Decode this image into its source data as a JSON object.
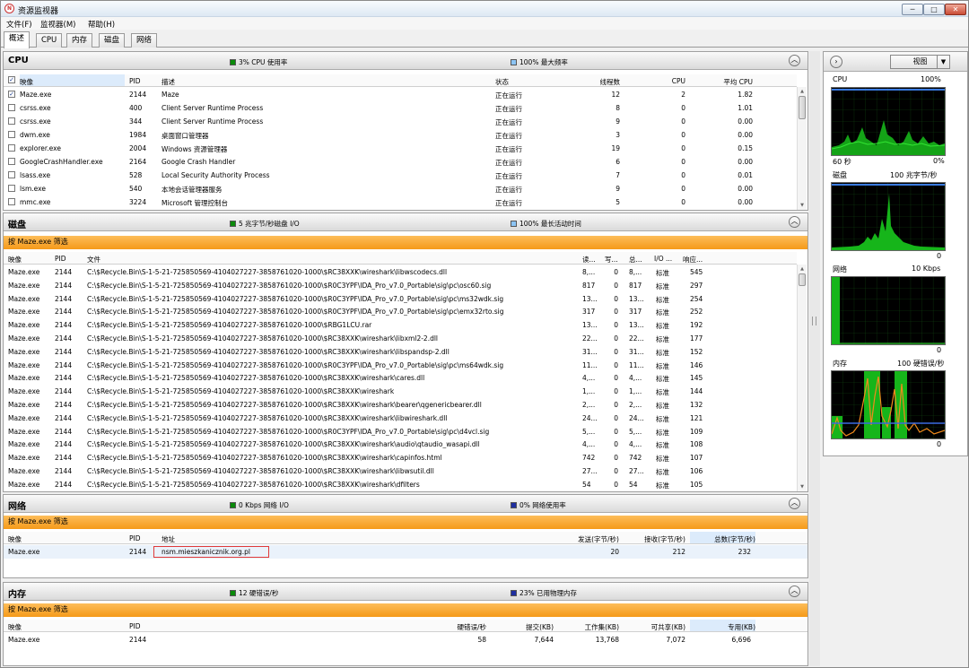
{
  "window": {
    "title": "资源监视器",
    "icon": "resource-monitor-icon",
    "min_label": "─",
    "max_label": "□",
    "close_label": "✕"
  },
  "menu": [
    "文件(F)",
    "监视器(M)",
    "帮助(H)"
  ],
  "tabs": [
    "概述",
    "CPU",
    "内存",
    "磁盘",
    "网络"
  ],
  "cpu": {
    "title": "CPU",
    "stat1": "3% CPU 使用率",
    "stat2": "100% 最大频率",
    "columns": [
      "映像",
      "PID",
      "描述",
      "状态",
      "线程数",
      "CPU",
      "平均 CPU"
    ],
    "rows": [
      {
        "checked": true,
        "name": "Maze.exe",
        "pid": "2144",
        "desc": "Maze",
        "status": "正在运行",
        "threads": "12",
        "cpu": "2",
        "avg": "1.82"
      },
      {
        "checked": false,
        "name": "csrss.exe",
        "pid": "400",
        "desc": "Client Server Runtime Process",
        "status": "正在运行",
        "threads": "8",
        "cpu": "0",
        "avg": "1.01"
      },
      {
        "checked": false,
        "name": "csrss.exe",
        "pid": "344",
        "desc": "Client Server Runtime Process",
        "status": "正在运行",
        "threads": "9",
        "cpu": "0",
        "avg": "0.00"
      },
      {
        "checked": false,
        "name": "dwm.exe",
        "pid": "1984",
        "desc": "桌面窗口管理器",
        "status": "正在运行",
        "threads": "3",
        "cpu": "0",
        "avg": "0.00"
      },
      {
        "checked": false,
        "name": "explorer.exe",
        "pid": "2004",
        "desc": "Windows 资源管理器",
        "status": "正在运行",
        "threads": "19",
        "cpu": "0",
        "avg": "0.15"
      },
      {
        "checked": false,
        "name": "GoogleCrashHandler.exe",
        "pid": "2164",
        "desc": "Google Crash Handler",
        "status": "正在运行",
        "threads": "6",
        "cpu": "0",
        "avg": "0.00"
      },
      {
        "checked": false,
        "name": "lsass.exe",
        "pid": "528",
        "desc": "Local Security Authority Process",
        "status": "正在运行",
        "threads": "7",
        "cpu": "0",
        "avg": "0.01"
      },
      {
        "checked": false,
        "name": "lsm.exe",
        "pid": "540",
        "desc": "本地会话管理器服务",
        "status": "正在运行",
        "threads": "9",
        "cpu": "0",
        "avg": "0.00"
      },
      {
        "checked": false,
        "name": "mmc.exe",
        "pid": "3224",
        "desc": "Microsoft 管理控制台",
        "status": "正在运行",
        "threads": "5",
        "cpu": "0",
        "avg": "0.00"
      }
    ]
  },
  "disk": {
    "title": "磁盘",
    "stat1": "5 兆字节/秒磁盘 I/O",
    "stat2": "100% 最长活动时间",
    "filter": "按 Maze.exe 筛选",
    "columns": [
      "映像",
      "PID",
      "文件",
      "读...",
      "写...",
      "总...",
      "I/O ...",
      "响应..."
    ],
    "rows": [
      {
        "name": "Maze.exe",
        "pid": "2144",
        "file": "C:\\$Recycle.Bin\\S-1-5-21-725850569-4104027227-3858761020-1000\\$RC38XXK\\wireshark\\libwscodecs.dll",
        "read": "8,...",
        "write": "0",
        "total": "8,...",
        "prio": "标准",
        "resp": "545"
      },
      {
        "name": "Maze.exe",
        "pid": "2144",
        "file": "C:\\$Recycle.Bin\\S-1-5-21-725850569-4104027227-3858761020-1000\\$R0C3YPF\\IDA_Pro_v7.0_Portable\\sig\\pc\\osc60.sig",
        "read": "817",
        "write": "0",
        "total": "817",
        "prio": "标准",
        "resp": "297"
      },
      {
        "name": "Maze.exe",
        "pid": "2144",
        "file": "C:\\$Recycle.Bin\\S-1-5-21-725850569-4104027227-3858761020-1000\\$R0C3YPF\\IDA_Pro_v7.0_Portable\\sig\\pc\\ms32wdk.sig",
        "read": "13...",
        "write": "0",
        "total": "13...",
        "prio": "标准",
        "resp": "254"
      },
      {
        "name": "Maze.exe",
        "pid": "2144",
        "file": "C:\\$Recycle.Bin\\S-1-5-21-725850569-4104027227-3858761020-1000\\$R0C3YPF\\IDA_Pro_v7.0_Portable\\sig\\pc\\emx32rto.sig",
        "read": "317",
        "write": "0",
        "total": "317",
        "prio": "标准",
        "resp": "252"
      },
      {
        "name": "Maze.exe",
        "pid": "2144",
        "file": "C:\\$Recycle.Bin\\S-1-5-21-725850569-4104027227-3858761020-1000\\$RBG1LCU.rar",
        "read": "13...",
        "write": "0",
        "total": "13...",
        "prio": "标准",
        "resp": "192"
      },
      {
        "name": "Maze.exe",
        "pid": "2144",
        "file": "C:\\$Recycle.Bin\\S-1-5-21-725850569-4104027227-3858761020-1000\\$RC38XXK\\wireshark\\libxml2-2.dll",
        "read": "22...",
        "write": "0",
        "total": "22...",
        "prio": "标准",
        "resp": "177"
      },
      {
        "name": "Maze.exe",
        "pid": "2144",
        "file": "C:\\$Recycle.Bin\\S-1-5-21-725850569-4104027227-3858761020-1000\\$RC38XXK\\wireshark\\libspandsp-2.dll",
        "read": "31...",
        "write": "0",
        "total": "31...",
        "prio": "标准",
        "resp": "152"
      },
      {
        "name": "Maze.exe",
        "pid": "2144",
        "file": "C:\\$Recycle.Bin\\S-1-5-21-725850569-4104027227-3858761020-1000\\$R0C3YPF\\IDA_Pro_v7.0_Portable\\sig\\pc\\ms64wdk.sig",
        "read": "11...",
        "write": "0",
        "total": "11...",
        "prio": "标准",
        "resp": "146"
      },
      {
        "name": "Maze.exe",
        "pid": "2144",
        "file": "C:\\$Recycle.Bin\\S-1-5-21-725850569-4104027227-3858761020-1000\\$RC38XXK\\wireshark\\cares.dll",
        "read": "4,...",
        "write": "0",
        "total": "4,...",
        "prio": "标准",
        "resp": "145"
      },
      {
        "name": "Maze.exe",
        "pid": "2144",
        "file": "C:\\$Recycle.Bin\\S-1-5-21-725850569-4104027227-3858761020-1000\\$RC38XXK\\wireshark",
        "read": "1,...",
        "write": "0",
        "total": "1,...",
        "prio": "标准",
        "resp": "144"
      },
      {
        "name": "Maze.exe",
        "pid": "2144",
        "file": "C:\\$Recycle.Bin\\S-1-5-21-725850569-4104027227-3858761020-1000\\$RC38XXK\\wireshark\\bearer\\qgenericbearer.dll",
        "read": "2,...",
        "write": "0",
        "total": "2,...",
        "prio": "标准",
        "resp": "132"
      },
      {
        "name": "Maze.exe",
        "pid": "2144",
        "file": "C:\\$Recycle.Bin\\S-1-5-21-725850569-4104027227-3858761020-1000\\$RC38XXK\\wireshark\\libwireshark.dll",
        "read": "24...",
        "write": "0",
        "total": "24...",
        "prio": "标准",
        "resp": "121"
      },
      {
        "name": "Maze.exe",
        "pid": "2144",
        "file": "C:\\$Recycle.Bin\\S-1-5-21-725850569-4104027227-3858761020-1000\\$R0C3YPF\\IDA_Pro_v7.0_Portable\\sig\\pc\\d4vcl.sig",
        "read": "5,...",
        "write": "0",
        "total": "5,...",
        "prio": "标准",
        "resp": "109"
      },
      {
        "name": "Maze.exe",
        "pid": "2144",
        "file": "C:\\$Recycle.Bin\\S-1-5-21-725850569-4104027227-3858761020-1000\\$RC38XXK\\wireshark\\audio\\qtaudio_wasapi.dll",
        "read": "4,...",
        "write": "0",
        "total": "4,...",
        "prio": "标准",
        "resp": "108"
      },
      {
        "name": "Maze.exe",
        "pid": "2144",
        "file": "C:\\$Recycle.Bin\\S-1-5-21-725850569-4104027227-3858761020-1000\\$RC38XXK\\wireshark\\capinfos.html",
        "read": "742",
        "write": "0",
        "total": "742",
        "prio": "标准",
        "resp": "107"
      },
      {
        "name": "Maze.exe",
        "pid": "2144",
        "file": "C:\\$Recycle.Bin\\S-1-5-21-725850569-4104027227-3858761020-1000\\$RC38XXK\\wireshark\\libwsutil.dll",
        "read": "27...",
        "write": "0",
        "total": "27...",
        "prio": "标准",
        "resp": "106"
      },
      {
        "name": "Maze.exe",
        "pid": "2144",
        "file": "C:\\$Recycle.Bin\\S-1-5-21-725850569-4104027227-3858761020-1000\\$RC38XXK\\wireshark\\dfilters",
        "read": "54",
        "write": "0",
        "total": "54",
        "prio": "标准",
        "resp": "105"
      }
    ]
  },
  "network": {
    "title": "网络",
    "stat1": "0 Kbps 网络 I/O",
    "stat2": "0% 网络使用率",
    "filter": "按 Maze.exe 筛选",
    "columns": [
      "映像",
      "PID",
      "地址",
      "发送(字节/秒)",
      "接收(字节/秒)",
      "总数(字节/秒)"
    ],
    "rows": [
      {
        "name": "Maze.exe",
        "pid": "2144",
        "addr": "nsm.mieszkanicznik.org.pl",
        "send": "20",
        "recv": "212",
        "total": "232"
      }
    ]
  },
  "memory": {
    "title": "内存",
    "stat1": "12 硬错误/秒",
    "stat2": "23% 已用物理内存",
    "filter": "按 Maze.exe 筛选",
    "columns": [
      "映像",
      "PID",
      "硬错误/秒",
      "提交(KB)",
      "工作集(KB)",
      "可共享(KB)",
      "专用(KB)"
    ],
    "rows": [
      {
        "name": "Maze.exe",
        "pid": "2144",
        "hard": "58",
        "commit": "7,644",
        "ws": "13,768",
        "share": "7,072",
        "priv": "6,696"
      }
    ]
  },
  "graphs": {
    "view_label": "视图",
    "cpu": {
      "label": "CPU",
      "max": "100%",
      "left_bottom": "60 秒",
      "right_bottom": "0%"
    },
    "disk": {
      "label": "磁盘",
      "max": "100 兆字节/秒",
      "right_bottom": "0"
    },
    "net": {
      "label": "网络",
      "max": "10 Kbps",
      "right_bottom": "0"
    },
    "mem": {
      "label": "内存",
      "max": "100 硬错误/秒",
      "right_bottom": "0"
    }
  },
  "colors": {
    "accent_green": "#0a8a0a",
    "accent_blue": "#1f4fc4",
    "filter_orange": "#f7a021",
    "selection": "#dcebfb",
    "highlight_box": "#e03a3a"
  }
}
